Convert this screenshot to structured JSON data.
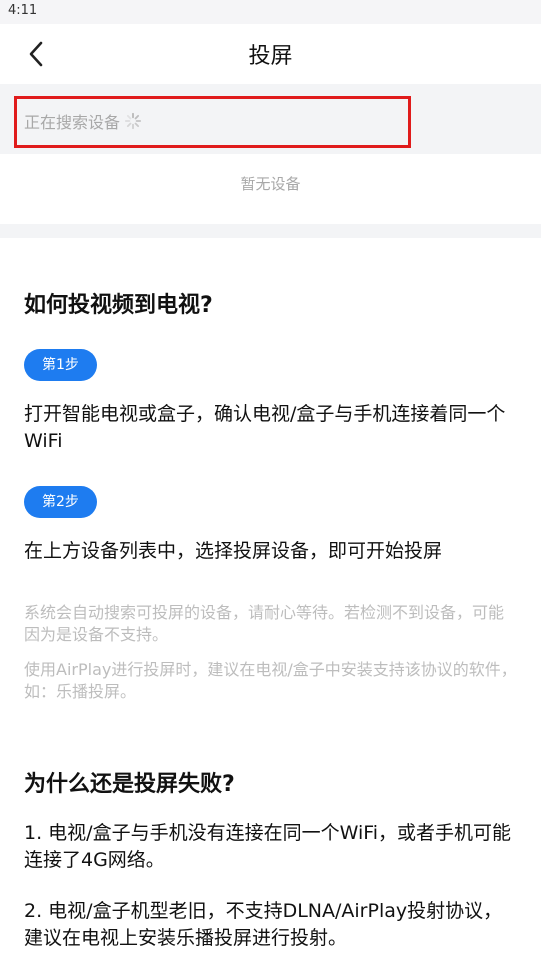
{
  "status_bar": {
    "time": "4:11"
  },
  "nav": {
    "title": "投屏",
    "back_icon": "chevron-left-icon"
  },
  "devices": {
    "searching_label": "正在搜索设备",
    "empty_label": "暂无设备",
    "highlight_color": "#e01b1b"
  },
  "guide": {
    "heading": "如何投视频到电视?",
    "steps": [
      {
        "badge": "第1步",
        "text": "打开智能电视或盒子，确认电视/盒子与手机连接着同一个WiFi"
      },
      {
        "badge": "第2步",
        "text": "在上方设备列表中，选择投屏设备，即可开始投屏"
      }
    ],
    "notes": [
      "系统会自动搜索可投屏的设备，请耐心等待。若检测不到设备，可能因为是设备不支持。",
      "使用AirPlay进行投屏时，建议在电视/盒子中安装支持该协议的软件，如：乐播投屏。"
    ]
  },
  "faq": {
    "heading": "为什么还是投屏失败?",
    "items": [
      "1. 电视/盒子与手机没有连接在同一个WiFi，或者手机可能连接了4G网络。",
      "2. 电视/盒子机型老旧，不支持DLNA/AirPlay投射协议，建议在电视上安装乐播投屏进行投射。"
    ]
  },
  "colors": {
    "accent": "#1e7cf0",
    "muted_text": "#a8a8a8",
    "note_text": "#bdbdbd",
    "panel_bg": "#f3f4f6"
  }
}
